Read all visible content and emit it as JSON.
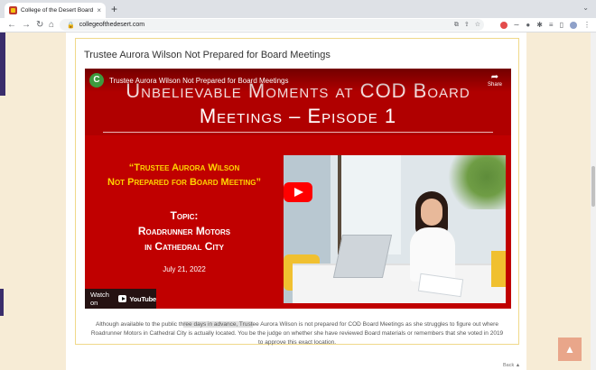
{
  "browser": {
    "tab_title": "College of the Desert Board of T",
    "tab_close": "×",
    "new_tab": "+",
    "tab_dropdown": "⌄",
    "url": "collegeofthedesert.com",
    "nav": {
      "back": "←",
      "forward": "→",
      "reload": "↻",
      "home": "⌂"
    },
    "icons": [
      "lock-icon",
      "share-icon",
      "star-icon",
      "extension-icon",
      "puzzle-icon",
      "reading-list-icon",
      "sidebar-icon",
      "profile-icon",
      "menu-icon"
    ]
  },
  "post": {
    "title": "Trustee Aurora Wilson Not Prepared for Board Meetings",
    "video": {
      "channel_initial": "C",
      "yt_title": "Trustee Aurora Wilson Not Prepared for Board Meetings",
      "share_label": "Share",
      "banner_line1": "Unbelievable Moments at COD Board",
      "banner_line2": "Meetings – Episode 1",
      "quote_line1": "“Trustee Aurora Wilson",
      "quote_line2": "Not Prepared for  Board Meeting”",
      "topic_label": "Topic:",
      "topic_line1": "Roadrunner Motors",
      "topic_line2": "in Cathedral City",
      "date": "July 21, 2022",
      "watch_on": "Watch on",
      "youtube_word": "YouTube"
    },
    "caption_part1": "Although available to the public th",
    "caption_highlight": "ree days in advance, Trust",
    "caption_part2": "ee Aurora Wilson is not prepared for COD Board Meetings as she struggles to figure out where Roadrunner Motors in Cathedral City is actually located.  You be the judge on whether she have reviewed Board materials or remembers that she voted in 2019 to approve this exact location."
  },
  "footer": {
    "back_label": "Back ▲",
    "top_button": "▲"
  },
  "colors": {
    "video_red": "#c00000",
    "quote_yellow": "#ffd400",
    "page_bg": "#f7ecd6",
    "top_button": "#e9a68a"
  }
}
